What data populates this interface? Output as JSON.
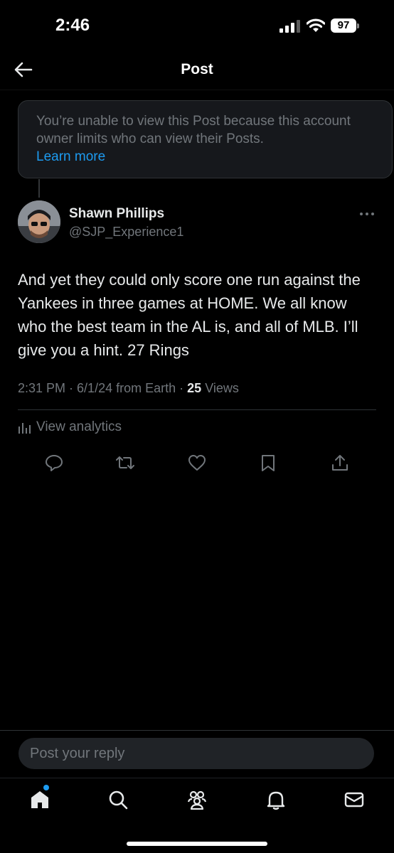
{
  "status_bar": {
    "time": "2:46",
    "battery": "97"
  },
  "header": {
    "title": "Post"
  },
  "notice": {
    "text": "You’re unable to view this Post because this account owner limits who can view their Posts.",
    "link": "Learn more"
  },
  "author": {
    "name": "Shawn Phillips",
    "handle": "@SJP_Experience1"
  },
  "post": {
    "text": "And yet they could only score one run against the Yankees in three games at HOME. We all know who the best team in the AL is, and all of MLB. I’ll give you a hint. 27 Rings",
    "time": "2:31 PM",
    "date": "6/1/24",
    "source": "from Earth",
    "views_count": "25",
    "views_label": "Views"
  },
  "analytics": {
    "label": "View analytics"
  },
  "actions": [
    "reply-icon",
    "repost-icon",
    "like-icon",
    "bookmark-icon",
    "share-icon"
  ],
  "reply": {
    "placeholder": "Post your reply"
  },
  "tab_bar": [
    "home-icon",
    "search-icon",
    "communities-icon",
    "notifications-icon",
    "messages-icon"
  ],
  "colors": {
    "accent": "#1d9bf0",
    "background": "#000000",
    "secondary_text": "#71767b"
  }
}
